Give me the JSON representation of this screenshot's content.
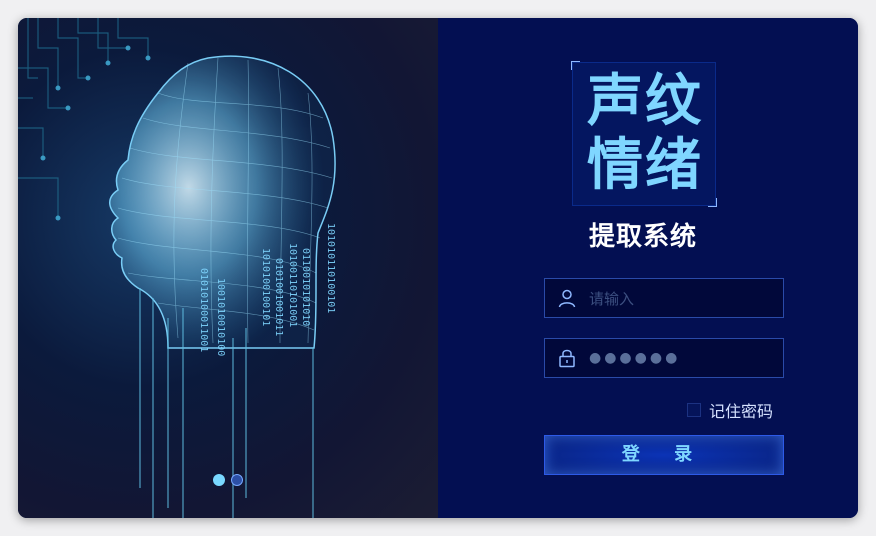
{
  "title": {
    "line1": "声纹",
    "line2": "情绪",
    "subtitle": "提取系统"
  },
  "form": {
    "username_placeholder": "请输入",
    "password_mask": "●●●●●●",
    "remember_label": "记住密码",
    "login_label": "登 录"
  },
  "carousel": {
    "count": 2,
    "active": 0
  },
  "colors": {
    "accent": "#7fd6ff",
    "panel": "#030f52",
    "button": "#0a2890"
  },
  "icons": {
    "user": "user-icon",
    "lock": "lock-icon"
  }
}
